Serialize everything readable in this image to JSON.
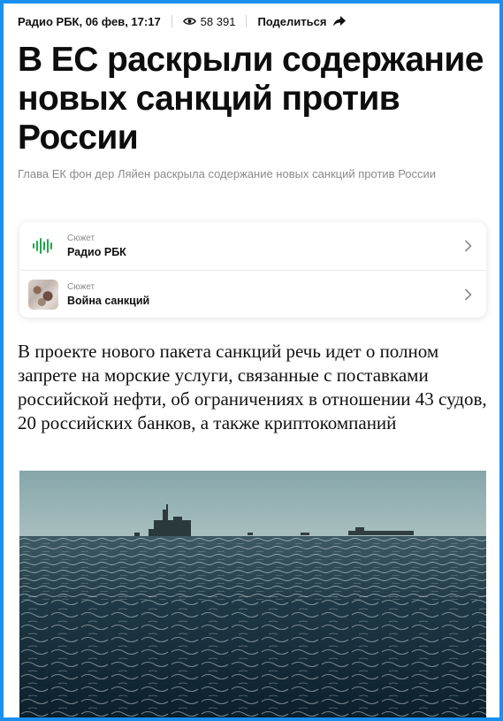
{
  "meta": {
    "source_date": "Радио РБК, 06 фев, 17:17",
    "views": "58 391",
    "share_label": "Поделиться"
  },
  "article": {
    "title": "В ЕС раскрыли содержание новых санкций против России",
    "subtitle": "Глава ЕК фон дер Ляйен раскрыла содержание новых санкций против России",
    "lead": "В проекте нового пакета санкций речь идет о полном запрете на морские услуги, связанные с поставками российской нефти, об ограничениях в отношении 43 судов, 20 российских банков, а также криптокомпаний"
  },
  "stories": [
    {
      "kind": "Сюжет",
      "name": "Радио РБК",
      "icon": "radio-wave-icon"
    },
    {
      "kind": "Сюжет",
      "name": "Война санкций",
      "icon": "map-thumbnail"
    }
  ],
  "colors": {
    "frame_border": "#1a8ff0",
    "radio_icon": "#1fa84f",
    "subtitle": "#8a8a8a"
  }
}
